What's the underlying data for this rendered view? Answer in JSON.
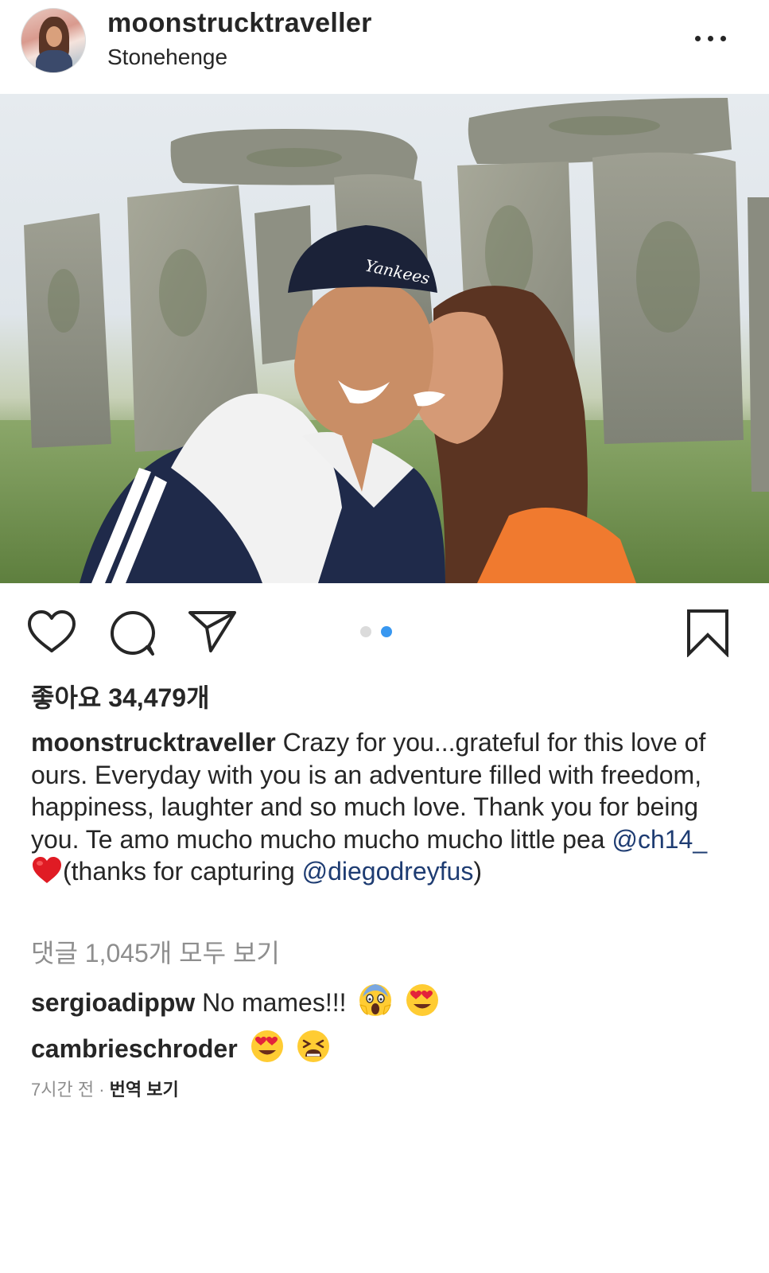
{
  "post": {
    "username": "moonstrucktraveller",
    "location": "Stonehenge",
    "more_icon": "more-horizontal-icon"
  },
  "photo": {
    "carousel_index": 2,
    "carousel_total": 2
  },
  "actions": {
    "like_icon": "heart-outline-icon",
    "comment_icon": "comment-bubble-icon",
    "share_icon": "paper-plane-icon",
    "save_icon": "bookmark-outline-icon",
    "active_dot_color": "#3897f0",
    "inactive_dot_color": "#dbdbdb"
  },
  "likes": "좋아요 34,479개",
  "caption": {
    "username": "moonstrucktraveller",
    "text_1": " Crazy for you...grateful for this love of ours. Everyday with you is an adventure filled with freedom, happiness, laughter and so much love. Thank you for being you. Te amo mucho mucho mucho mucho little pea ",
    "mention_1": "@ch14_",
    "emoji_1": "red-heart",
    "text_2": "(thanks for capturing ",
    "mention_2": "@diegodreyfus",
    "text_3": ")"
  },
  "view_comments": "댓글 1,045개 모두 보기",
  "comments": [
    {
      "username": "sergioadippw",
      "text": " No mames!!! ",
      "emojis": [
        "face-screaming-in-fear",
        "smiling-face-with-heart-eyes"
      ]
    },
    {
      "username": "cambrieschroder",
      "text": " ",
      "emojis": [
        "smiling-face-with-heart-eyes",
        "tired-face"
      ]
    }
  ],
  "timestamp": "7시간 전",
  "separator": " · ",
  "translate": "번역 보기"
}
